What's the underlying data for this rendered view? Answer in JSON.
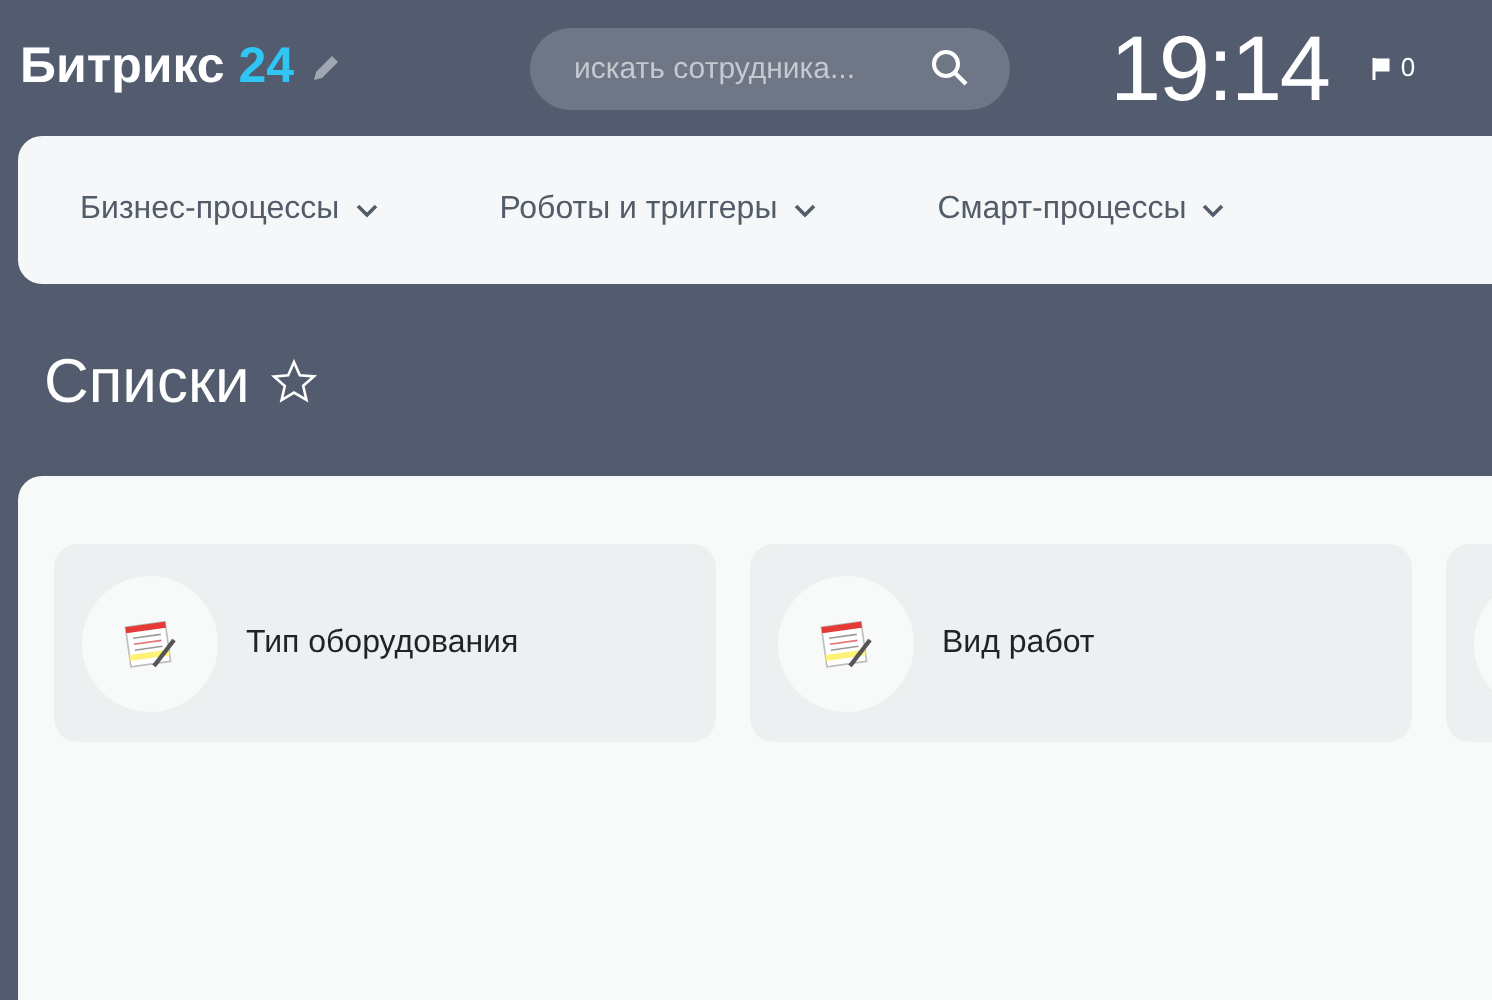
{
  "header": {
    "logo_name": "Битрикс",
    "logo_number": "24",
    "search": {
      "placeholder": "искать сотрудника..."
    },
    "clock": "19:14",
    "flag_count": "0"
  },
  "nav": [
    {
      "label": "Бизнес-процессы"
    },
    {
      "label": "Роботы и триггеры"
    },
    {
      "label": "Смарт-процессы"
    }
  ],
  "page": {
    "title": "Списки",
    "favorite": false
  },
  "lists": [
    {
      "name": "Тип оборудования"
    },
    {
      "name": "Вид работ"
    }
  ]
}
